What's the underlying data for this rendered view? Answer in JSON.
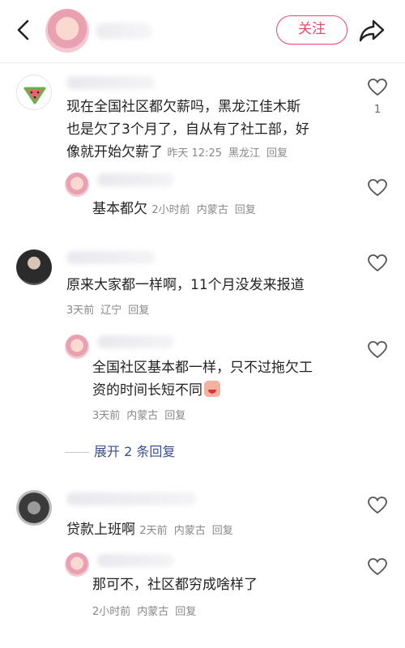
{
  "header": {
    "follow_label": "关注"
  },
  "comments": [
    {
      "text_line1": "现在全国社区都欠薪吗，黑龙江佳木斯",
      "text_line2": "也是欠了3个月了，自从有了社工部，好",
      "text_line3": "像就开始欠薪了",
      "time": "昨天 12:25",
      "location": "黑龙江",
      "reply": "回复",
      "likes": "1"
    },
    {
      "text": "基本都欠",
      "time": "2小时前",
      "location": "内蒙古",
      "reply": "回复"
    },
    {
      "text": "原来大家都一样啊，11个月没发来报道",
      "time": "3天前",
      "location": "辽宁",
      "reply": "回复"
    },
    {
      "text_line1": "全国社区基本都一样，只不过拖欠工",
      "text_line2": "资的时间长短不同",
      "time": "3天前",
      "location": "内蒙古",
      "reply": "回复"
    },
    {
      "text": "贷款上班啊",
      "time": "2天前",
      "location": "内蒙古",
      "reply": "回复"
    },
    {
      "text": "那可不，社区都穷成啥样了",
      "time": "2小时前",
      "location": "内蒙古",
      "reply": "回复"
    }
  ],
  "expand_replies": "展开 2 条回复",
  "colors": {
    "accent": "#e8476a",
    "link": "#3a4f8f",
    "meta": "#888888"
  },
  "icons": [
    "back-arrow-icon",
    "share-icon",
    "heart-icon",
    "watermelon-icon"
  ]
}
